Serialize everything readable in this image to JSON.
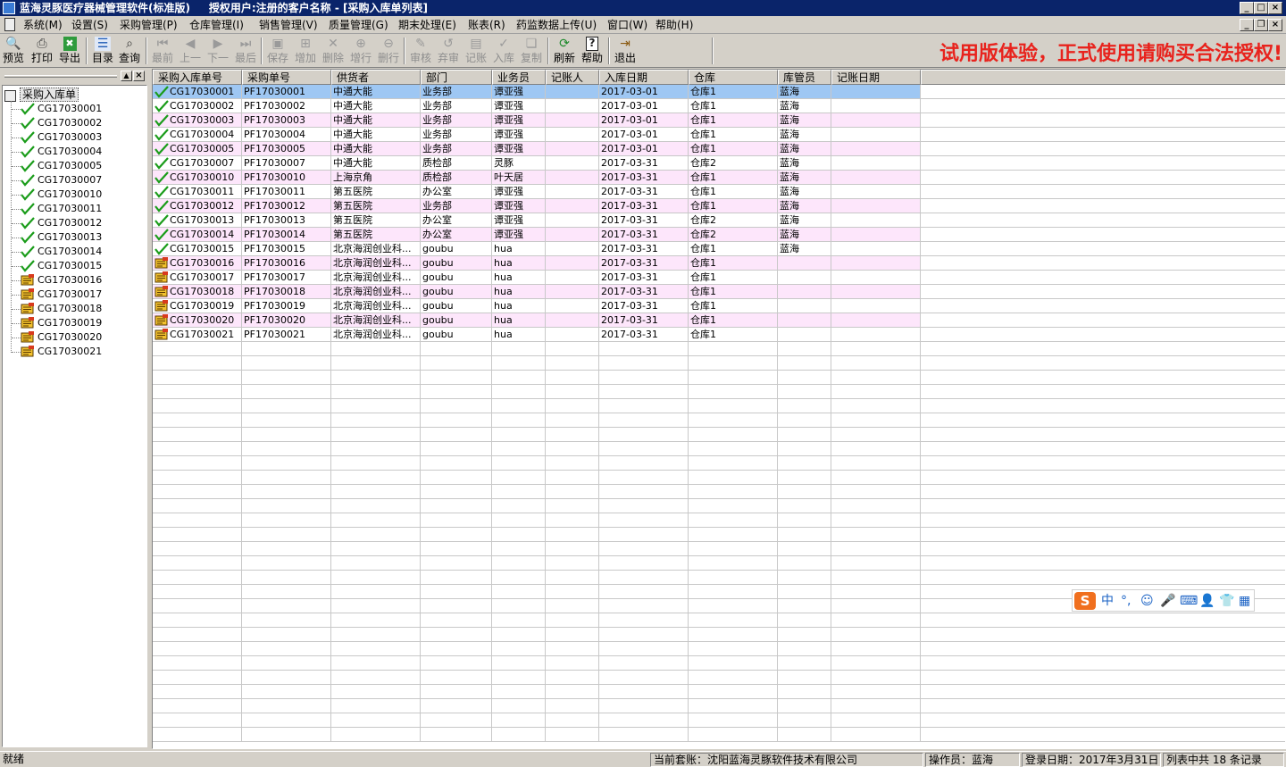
{
  "window": {
    "title": "蓝海灵豚医疗器械管理软件(标准版)     授权用户:注册的客户名称 - [采购入库单列表]"
  },
  "menu": {
    "items": [
      "系统(M)",
      "设置(S)",
      "采购管理(P)",
      "仓库管理(I)",
      "销售管理(V)",
      "质量管理(G)",
      "期末处理(E)",
      "账表(R)",
      "药监数据上传(U)",
      "窗口(W)",
      "帮助(H)"
    ]
  },
  "toolbar": {
    "buttons": [
      {
        "label": "预览",
        "icon": "preview-icon",
        "enabled": true
      },
      {
        "label": "打印",
        "icon": "print-icon",
        "enabled": true
      },
      {
        "label": "导出",
        "icon": "export-icon",
        "enabled": true
      },
      {
        "label": "目录",
        "icon": "catalog-icon",
        "enabled": true
      },
      {
        "label": "查询",
        "icon": "query-icon",
        "enabled": true
      },
      {
        "label": "最前",
        "icon": "first-icon",
        "enabled": false
      },
      {
        "label": "上一",
        "icon": "prev-icon",
        "enabled": false
      },
      {
        "label": "下一",
        "icon": "next-icon",
        "enabled": false
      },
      {
        "label": "最后",
        "icon": "last-icon",
        "enabled": false
      },
      {
        "label": "保存",
        "icon": "save-icon",
        "enabled": false
      },
      {
        "label": "增加",
        "icon": "add-icon",
        "enabled": false
      },
      {
        "label": "删除",
        "icon": "delete-icon",
        "enabled": false
      },
      {
        "label": "增行",
        "icon": "add-row-icon",
        "enabled": false
      },
      {
        "label": "删行",
        "icon": "delete-row-icon",
        "enabled": false
      },
      {
        "label": "审核",
        "icon": "audit-icon",
        "enabled": false
      },
      {
        "label": "弃审",
        "icon": "unaudit-icon",
        "enabled": false
      },
      {
        "label": "记账",
        "icon": "post-icon",
        "enabled": false
      },
      {
        "label": "入库",
        "icon": "stock-in-icon",
        "enabled": false
      },
      {
        "label": "复制",
        "icon": "copy-icon",
        "enabled": false
      },
      {
        "label": "刷新",
        "icon": "refresh-icon",
        "enabled": true
      },
      {
        "label": "帮助",
        "icon": "help-icon",
        "enabled": true
      },
      {
        "label": "退出",
        "icon": "exit-icon",
        "enabled": true
      }
    ],
    "trial_notice": "试用版体验，正式使用请购买合法授权!"
  },
  "tree": {
    "root": "采购入库单",
    "items": [
      {
        "label": "CG17030001",
        "status": "checked"
      },
      {
        "label": "CG17030002",
        "status": "checked"
      },
      {
        "label": "CG17030003",
        "status": "checked"
      },
      {
        "label": "CG17030004",
        "status": "checked"
      },
      {
        "label": "CG17030005",
        "status": "checked"
      },
      {
        "label": "CG17030007",
        "status": "checked"
      },
      {
        "label": "CG17030010",
        "status": "checked"
      },
      {
        "label": "CG17030011",
        "status": "checked"
      },
      {
        "label": "CG17030012",
        "status": "checked"
      },
      {
        "label": "CG17030013",
        "status": "checked"
      },
      {
        "label": "CG17030014",
        "status": "checked"
      },
      {
        "label": "CG17030015",
        "status": "checked"
      },
      {
        "label": "CG17030016",
        "status": "pending"
      },
      {
        "label": "CG17030017",
        "status": "pending"
      },
      {
        "label": "CG17030018",
        "status": "pending"
      },
      {
        "label": "CG17030019",
        "status": "pending"
      },
      {
        "label": "CG17030020",
        "status": "pending"
      },
      {
        "label": "CG17030021",
        "status": "pending"
      }
    ]
  },
  "grid": {
    "columns": [
      "采购入库单号",
      "采购单号",
      "供货者",
      "部门",
      "业务员",
      "记账人",
      "入库日期",
      "仓库",
      "库管员",
      "记账日期"
    ],
    "rows": [
      {
        "status": "checked",
        "cells": [
          "CG17030001",
          "PF17030001",
          "中通大能",
          "业务部",
          "谭亚强",
          "",
          "2017-03-01",
          "仓库1",
          "蓝海",
          ""
        ]
      },
      {
        "status": "checked",
        "cells": [
          "CG17030002",
          "PF17030002",
          "中通大能",
          "业务部",
          "谭亚强",
          "",
          "2017-03-01",
          "仓库1",
          "蓝海",
          ""
        ]
      },
      {
        "status": "checked",
        "cells": [
          "CG17030003",
          "PF17030003",
          "中通大能",
          "业务部",
          "谭亚强",
          "",
          "2017-03-01",
          "仓库1",
          "蓝海",
          ""
        ]
      },
      {
        "status": "checked",
        "cells": [
          "CG17030004",
          "PF17030004",
          "中通大能",
          "业务部",
          "谭亚强",
          "",
          "2017-03-01",
          "仓库1",
          "蓝海",
          ""
        ]
      },
      {
        "status": "checked",
        "cells": [
          "CG17030005",
          "PF17030005",
          "中通大能",
          "业务部",
          "谭亚强",
          "",
          "2017-03-01",
          "仓库1",
          "蓝海",
          ""
        ]
      },
      {
        "status": "checked",
        "cells": [
          "CG17030007",
          "PF17030007",
          "中通大能",
          "质检部",
          "灵豚",
          "",
          "2017-03-31",
          "仓库2",
          "蓝海",
          ""
        ]
      },
      {
        "status": "checked",
        "cells": [
          "CG17030010",
          "PF17030010",
          "上海京角",
          "质检部",
          "叶天居",
          "",
          "2017-03-31",
          "仓库1",
          "蓝海",
          ""
        ]
      },
      {
        "status": "checked",
        "cells": [
          "CG17030011",
          "PF17030011",
          "第五医院",
          "办公室",
          "谭亚强",
          "",
          "2017-03-31",
          "仓库1",
          "蓝海",
          ""
        ]
      },
      {
        "status": "checked",
        "cells": [
          "CG17030012",
          "PF17030012",
          "第五医院",
          "业务部",
          "谭亚强",
          "",
          "2017-03-31",
          "仓库1",
          "蓝海",
          ""
        ]
      },
      {
        "status": "checked",
        "cells": [
          "CG17030013",
          "PF17030013",
          "第五医院",
          "办公室",
          "谭亚强",
          "",
          "2017-03-31",
          "仓库2",
          "蓝海",
          ""
        ]
      },
      {
        "status": "checked",
        "cells": [
          "CG17030014",
          "PF17030014",
          "第五医院",
          "办公室",
          "谭亚强",
          "",
          "2017-03-31",
          "仓库2",
          "蓝海",
          ""
        ]
      },
      {
        "status": "checked",
        "cells": [
          "CG17030015",
          "PF17030015",
          "北京海润创业科...",
          "goubu",
          "hua",
          "",
          "2017-03-31",
          "仓库1",
          "蓝海",
          ""
        ]
      },
      {
        "status": "pending",
        "cells": [
          "CG17030016",
          "PF17030016",
          "北京海润创业科...",
          "goubu",
          "hua",
          "",
          "2017-03-31",
          "仓库1",
          "",
          ""
        ]
      },
      {
        "status": "pending",
        "cells": [
          "CG17030017",
          "PF17030017",
          "北京海润创业科...",
          "goubu",
          "hua",
          "",
          "2017-03-31",
          "仓库1",
          "",
          ""
        ]
      },
      {
        "status": "pending",
        "cells": [
          "CG17030018",
          "PF17030018",
          "北京海润创业科...",
          "goubu",
          "hua",
          "",
          "2017-03-31",
          "仓库1",
          "",
          ""
        ]
      },
      {
        "status": "pending",
        "cells": [
          "CG17030019",
          "PF17030019",
          "北京海润创业科...",
          "goubu",
          "hua",
          "",
          "2017-03-31",
          "仓库1",
          "",
          ""
        ]
      },
      {
        "status": "pending",
        "cells": [
          "CG17030020",
          "PF17030020",
          "北京海润创业科...",
          "goubu",
          "hua",
          "",
          "2017-03-31",
          "仓库1",
          "",
          ""
        ]
      },
      {
        "status": "pending",
        "cells": [
          "CG17030021",
          "PF17030021",
          "北京海润创业科...",
          "goubu",
          "hua",
          "",
          "2017-03-31",
          "仓库1",
          "",
          ""
        ]
      }
    ],
    "selected_row": 0
  },
  "ime": {
    "logo": "S",
    "items": [
      "中",
      "°,",
      "☺",
      "🎤",
      "⌨",
      "👤",
      "👕",
      "▦"
    ]
  },
  "status": {
    "ready": "就绪",
    "account": "当前套账：沈阳蓝海灵豚软件技术有限公司",
    "operator": "操作员：蓝海",
    "login_date": "登录日期：2017年3月31日",
    "record_count": "列表中共 18 条记录"
  },
  "colors": {
    "titlebar": "#0a246a",
    "selected_row": "#9ec7f3",
    "alt_row": "#fde6fb",
    "trial_text": "#e8231d",
    "check": "#1a9c1a"
  }
}
